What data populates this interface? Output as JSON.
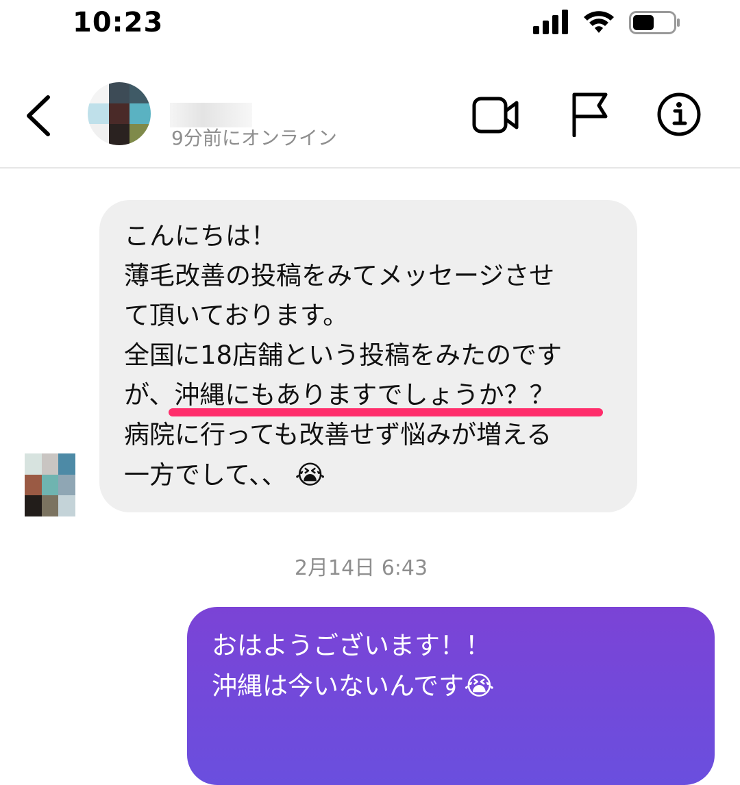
{
  "status_bar": {
    "time": "10:23"
  },
  "header": {
    "online_status": "9分前にオンライン"
  },
  "incoming_message": {
    "lines": [
      "こんにちは！",
      "薄毛改善の投稿をみてメッセージさせ",
      "て頂いております。",
      "全国に18店舗という投稿をみたのです",
      "が、沖縄にもありますでしょうか？？",
      "病院に行っても改善せず悩みが増える",
      "一方でして、、"
    ],
    "emoji": "😭"
  },
  "timestamp": "2月14日 6:43",
  "outgoing_message": {
    "lines": [
      "おはようございます！！",
      "沖縄は今いないんです"
    ],
    "emoji": "😭"
  },
  "colors": {
    "incoming_bubble": "#efefef",
    "outgoing_gradient_top": "#7b43d6",
    "outgoing_gradient_bottom": "#6a4fde",
    "highlight_underline": "#ff2d6b"
  },
  "icons": [
    "back-chevron-icon",
    "video-call-icon",
    "report-flag-icon",
    "info-icon",
    "cellular-signal-icon",
    "wifi-icon",
    "battery-icon"
  ]
}
